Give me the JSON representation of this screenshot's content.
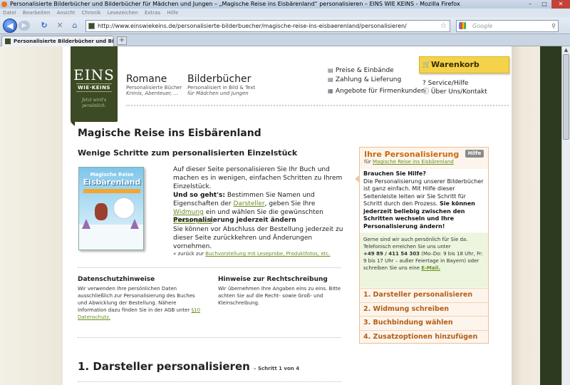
{
  "browser": {
    "window_title": "Personalisierte Bilderbücher und Bilderbücher für Mädchen und Jungen – „Magische Reise ins Eisbärenland“ personalisieren – EINS WIE KEINS - Mozilla Firefox",
    "window_buttons": [
      "–",
      "□",
      "✕"
    ],
    "menu": [
      "Datei",
      "Bearbeiten",
      "Ansicht",
      "Chronik",
      "Lesezeichen",
      "Extras",
      "Hilfe"
    ],
    "url": "http://www.einswiekeins.de/personalisierte-bilderbuecher/magische-reise-ins-eisbaerenland/personalisieren/",
    "search_placeholder": "Google",
    "tab_title": "Personalisierte Bilderbücher und Bild...",
    "tab_add": "+"
  },
  "site": {
    "logo": {
      "line1": "EINS",
      "line2": "WIE·KEINS",
      "tagline": "Jetzt wird's persönlich."
    },
    "nav": [
      {
        "title": "Romane",
        "sub1": "Personalisierte Bücher",
        "sub2": "Krimis, Abenteuer, ..."
      },
      {
        "title": "Bilderbücher",
        "sub1": "Personalisiert in Bild & Text",
        "sub2": "für Mädchen und Jungen"
      }
    ],
    "top_links": [
      "Preise & Einbände",
      "Zahlung & Lieferung",
      "Angebote für Firmenkunden"
    ],
    "cart_label": "Warenkorb",
    "service_links": [
      "Service/Hilfe",
      "Über Uns/Kontakt"
    ]
  },
  "main": {
    "title": "Magische Reise ins Eisbärenland",
    "subtitle": "Wenige Schritte zum personalisierten Einzelstück",
    "book": {
      "small_title": "Magische Reise",
      "big_title": "Eisbärenland"
    },
    "intro": {
      "p1": "Auf dieser Seite personalisieren Sie Ihr Buch und machen es in wenigen, einfachen Schritten zu Ihrem Einzelstück.",
      "p2_bold": "Und so geht's:",
      "p2_a": "Bestimmen Sie Namen und Eigenschaften der",
      "link_darsteller": "Darsteller",
      "p2_b": ", geben Sie Ihre",
      "link_widmung": "Widmung",
      "p2_c": "ein und wählen Sie die gewünschten",
      "link_bindung": "Bindungsart",
      "p2_d": "."
    },
    "change_title": "Personalisierung jederzeit ändern",
    "change_text": "Sie können vor Abschluss der Bestellung jederzeit zu dieser Seite zurückkehren und Änderungen vornehmen.",
    "back_prefix": "« zurück zur",
    "back_link": "Buchvorstellung mit Leseprobe, Produktfotos, etc.",
    "privacy": {
      "title": "Datenschutzhinweise",
      "text": "Wir verwenden Ihre persönlichen Daten ausschließlich zur Personalisierung des Buches und Abwicklung der Bestellung. Nähere Information dazu finden Sie in der AGB unter",
      "link": "§10 Datenschutz."
    },
    "spelling": {
      "title": "Hinweise zur Rechtschreibung",
      "text": "Wir übernehmen Ihre Angaben eins zu eins. Bitte achten Sie auf die Recht- sowie Groß- und Kleinschreibung."
    },
    "step_heading": "1. Darsteller personalisieren",
    "step_sub": "– Schritt 1 von 4"
  },
  "sidebar": {
    "title": "Ihre Personalisierung",
    "for_prefix": "für",
    "for_link": "Magische Reise ins Eisbärenland",
    "help_btn": "Hilfe",
    "q": "Brauchen Sie Hilfe?",
    "text": "Die Personalisierung unserer Bilderbücher ist ganz einfach. Mit Hilfe dieser Seitenleiste leiten wir Sie Schritt für Schritt durch den Prozess.",
    "text_bold": "Sie können jederzeit beliebig zwischen den Schritten wechseln und Ihre Personalisierung ändern!",
    "contact_a": "Gerne sind wir auch persönlich für Sie da. Telefonisch erreichen Sie uns unter",
    "phone": "+49 89 / 411 54 303",
    "contact_b": "(Mo–Do: 9 bis 18 Uhr, Fr: 9 bis 17 Uhr – außer Feiertage in Bayern) oder schreiben Sie uns eine",
    "email_link": "E-Mail.",
    "steps": [
      "1. Darsteller personalisieren",
      "2. Widmung schreiben",
      "3. Buchbindung wählen",
      "4. Zusatzoptionen hinzufügen"
    ]
  },
  "colors": {
    "brand_green": "#3c4a26",
    "accent_orange": "#c86a10",
    "link_green": "#6b8e23",
    "cart_yellow": "#f4d24a"
  }
}
